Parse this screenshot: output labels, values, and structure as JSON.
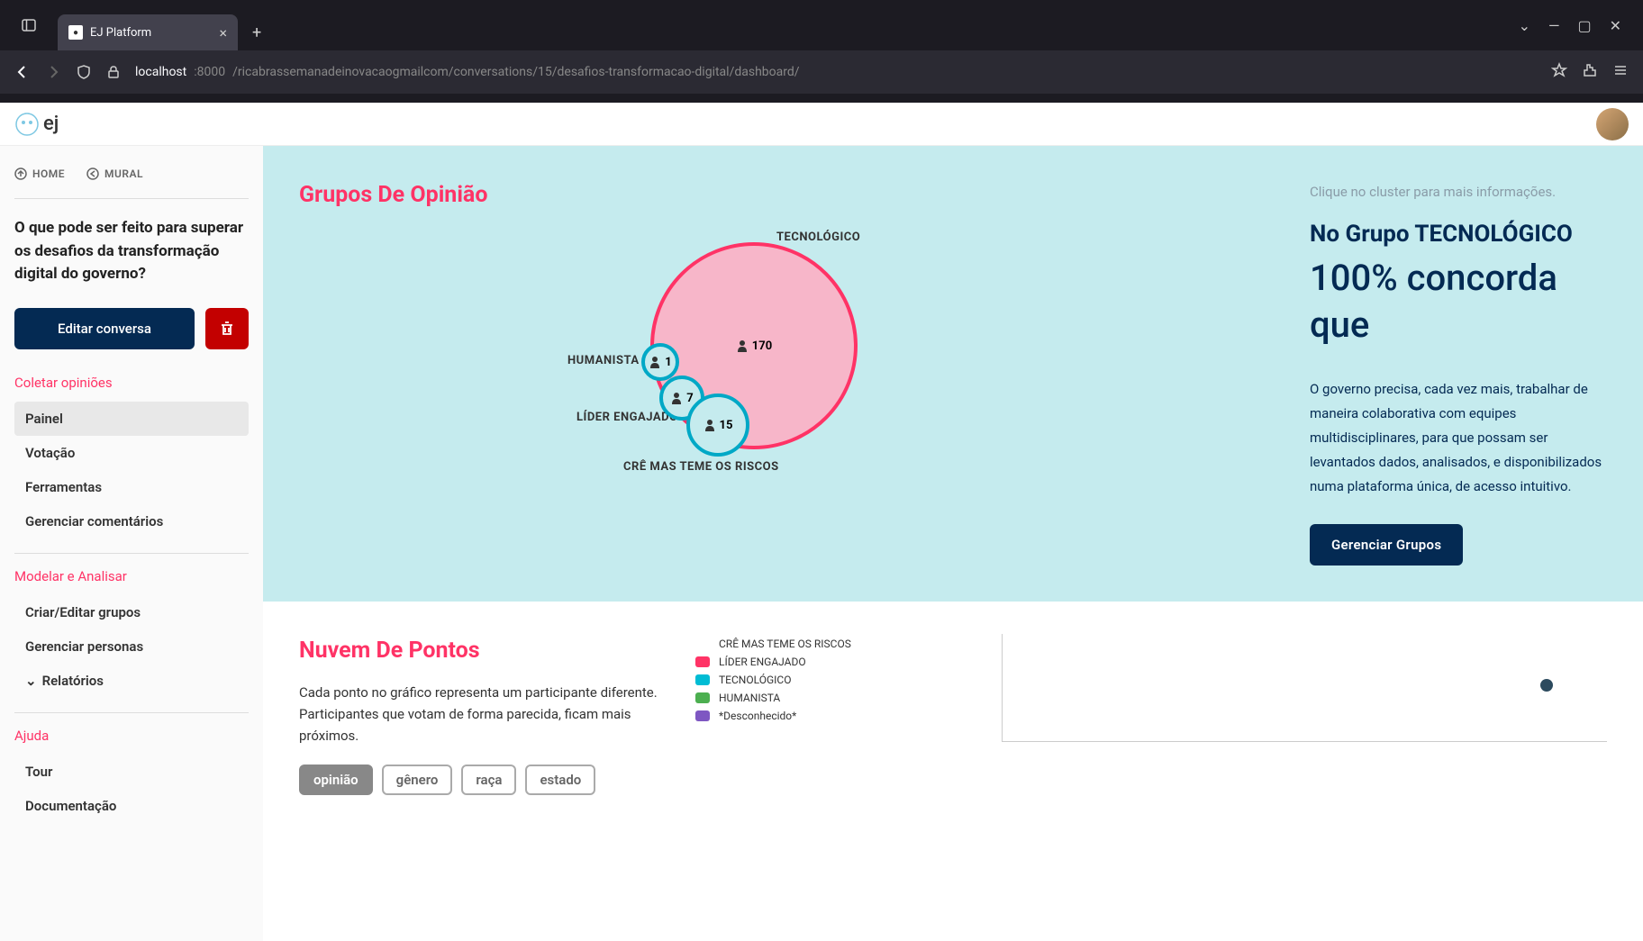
{
  "browser": {
    "tab_title": "EJ Platform",
    "url_host": "localhost",
    "url_port": ":8000",
    "url_path": "/ricabrassemanadeinovacaogmailcom/conversations/15/desafios-transformacao-digital/dashboard/"
  },
  "app": {
    "logo_text": "ej"
  },
  "breadcrumbs": {
    "home": "HOME",
    "mural": "MURAL"
  },
  "sidebar": {
    "title": "O que pode ser feito para superar os desafios da transformação digital do governo?",
    "edit_btn": "Editar conversa",
    "section_collect": "Coletar opiniões",
    "nav_painel": "Painel",
    "nav_votacao": "Votação",
    "nav_ferramentas": "Ferramentas",
    "nav_gerenciar_comentarios": "Gerenciar comentários",
    "section_model": "Modelar e Analisar",
    "nav_criar_grupos": "Criar/Editar grupos",
    "nav_gerenciar_personas": "Gerenciar personas",
    "nav_relatorios": "Relatórios",
    "section_ajuda": "Ajuda",
    "nav_tour": "Tour",
    "nav_documentacao": "Documentação"
  },
  "opinion": {
    "title": "Grupos De Opinião",
    "hint": "Clique no cluster para mais informações.",
    "group_title": "No Grupo TECNOLÓGICO",
    "group_stat": "100% concorda que",
    "group_desc": "O governo precisa, cada vez mais, trabalhar de maneira colaborativa com equipes multidisciplinares, para que possam ser levantados dados, analisados, e disponibilizados numa plataforma única, de acesso intuitivo.",
    "manage_btn": "Gerenciar Grupos",
    "clusters": {
      "tecnologico": {
        "label": "TECNOLÓGICO",
        "count": "170"
      },
      "humanista": {
        "label": "HUMANISTA",
        "count": "1"
      },
      "lider": {
        "label": "LÍDER ENGAJADO",
        "count": "7"
      },
      "cre": {
        "label": "CRÊ MAS TEME OS RISCOS",
        "count": "15"
      }
    }
  },
  "scatter": {
    "title": "Nuvem De Pontos",
    "desc": "Cada ponto no gráfico representa um participante diferente. Participantes que votam de forma parecida, ficam mais próximos.",
    "chips": {
      "opiniao": "opinião",
      "genero": "gênero",
      "raca": "raça",
      "estado": "estado"
    },
    "legend": {
      "cre": "CRÊ MAS TEME OS RISCOS",
      "lider": "LÍDER ENGAJADO",
      "tecnologico": "TECNOLÓGICO",
      "humanista": "HUMANISTA",
      "desconhecido": "*Desconhecido*"
    },
    "legend_colors": {
      "cre": "#042a53",
      "lider": "#ff3366",
      "tecnologico": "#00bcd4",
      "humanista": "#4caf50",
      "desconhecido": "#7e57c2"
    }
  },
  "chart_data": [
    {
      "type": "bubble",
      "title": "Grupos De Opinião",
      "series": [
        {
          "name": "TECNOLÓGICO",
          "value": 170,
          "color": "#ff3366"
        },
        {
          "name": "HUMANISTA",
          "value": 1,
          "color": "#00a8c6"
        },
        {
          "name": "LÍDER ENGAJADO",
          "value": 7,
          "color": "#00a8c6"
        },
        {
          "name": "CRÊ MAS TEME OS RISCOS",
          "value": 15,
          "color": "#00a8c6"
        }
      ]
    },
    {
      "type": "scatter",
      "title": "Nuvem De Pontos",
      "legend": [
        "CRÊ MAS TEME OS RISCOS",
        "LÍDER ENGAJADO",
        "TECNOLÓGICO",
        "HUMANISTA",
        "*Desconhecido*"
      ],
      "points": [
        {
          "x": 0.85,
          "y": 0.5,
          "group": "CRÊ MAS TEME OS RISCOS"
        }
      ]
    }
  ]
}
